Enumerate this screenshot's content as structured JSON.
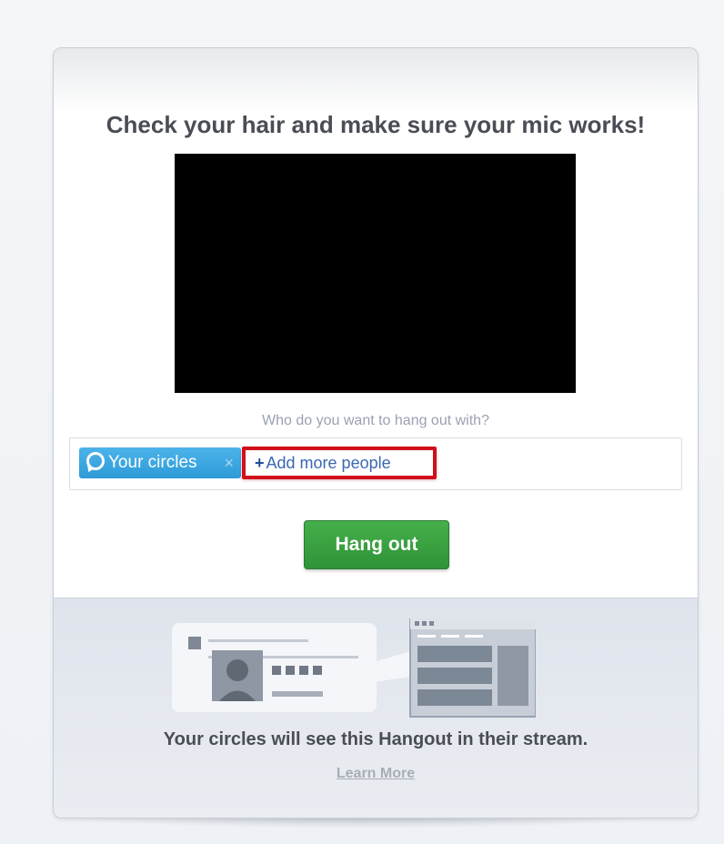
{
  "headline": "Check your hair and make sure your mic works!",
  "prompt": "Who do you want to hang out with?",
  "recipients": {
    "chip_label": "Your circles",
    "chip_close": "×",
    "add_plus": "+",
    "add_label": "Add more people"
  },
  "action": {
    "hang_out_label": "Hang out"
  },
  "footer": {
    "message": "Your circles will see this Hangout in their stream.",
    "learn_more": "Learn More"
  },
  "colors": {
    "chip_blue": "#2e9bd8",
    "button_green": "#3aa142",
    "highlight_red": "#d0101a"
  }
}
